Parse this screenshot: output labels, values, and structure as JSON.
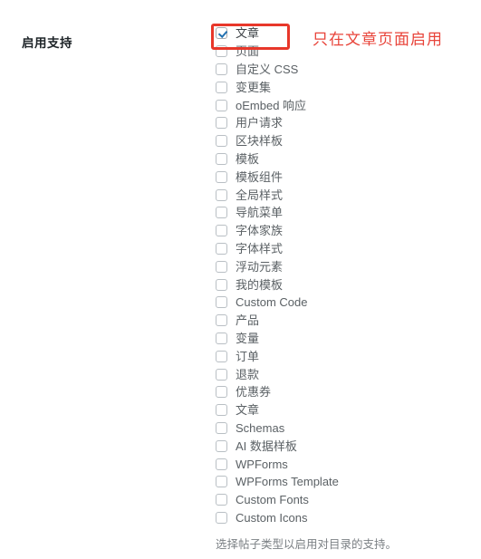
{
  "field": {
    "label": "启用支持",
    "description": "选择帖子类型以启用对目录的支持。"
  },
  "checkboxes": [
    {
      "label": "文章",
      "checked": true
    },
    {
      "label": "页面",
      "checked": false
    },
    {
      "label": "自定义 CSS",
      "checked": false
    },
    {
      "label": "变更集",
      "checked": false
    },
    {
      "label": "oEmbed 响应",
      "checked": false
    },
    {
      "label": "用户请求",
      "checked": false
    },
    {
      "label": "区块样板",
      "checked": false
    },
    {
      "label": "模板",
      "checked": false
    },
    {
      "label": "模板组件",
      "checked": false
    },
    {
      "label": "全局样式",
      "checked": false
    },
    {
      "label": "导航菜单",
      "checked": false
    },
    {
      "label": "字体家族",
      "checked": false
    },
    {
      "label": "字体样式",
      "checked": false
    },
    {
      "label": "浮动元素",
      "checked": false
    },
    {
      "label": "我的模板",
      "checked": false
    },
    {
      "label": "Custom Code",
      "checked": false
    },
    {
      "label": "产品",
      "checked": false
    },
    {
      "label": "变量",
      "checked": false
    },
    {
      "label": "订单",
      "checked": false
    },
    {
      "label": "退款",
      "checked": false
    },
    {
      "label": "优惠券",
      "checked": false
    },
    {
      "label": "文章",
      "checked": false
    },
    {
      "label": "Schemas",
      "checked": false
    },
    {
      "label": "AI 数据样板",
      "checked": false
    },
    {
      "label": "WPForms",
      "checked": false
    },
    {
      "label": "WPForms Template",
      "checked": false
    },
    {
      "label": "Custom Fonts",
      "checked": false
    },
    {
      "label": "Custom Icons",
      "checked": false
    }
  ],
  "annotation": {
    "text": "只在文章页面启用",
    "color": "#e8443a",
    "highlight_color": "#e8372a"
  }
}
